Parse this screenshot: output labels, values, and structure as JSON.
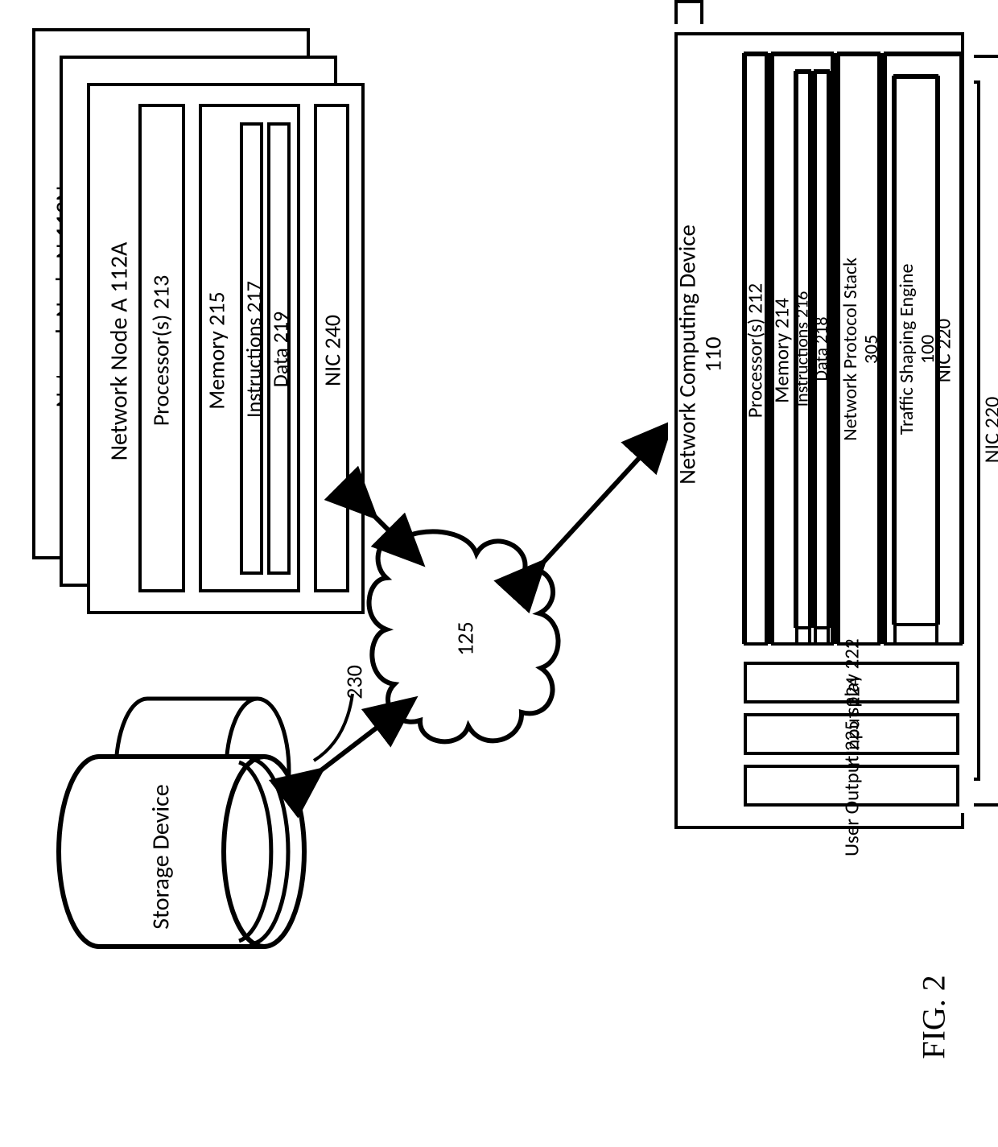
{
  "figure_label": "FIG. 2",
  "cloud": {
    "label": "125"
  },
  "network_node_n": {
    "title": "Network Node N 112N",
    "ellipsis": "…"
  },
  "network_node_a": {
    "title": "Network Node A 112A",
    "processor": "Processor(s) 213",
    "memory": "Memory 215",
    "instructions": "Instructions 217",
    "data": "Data 219",
    "nic": "NIC 240"
  },
  "storage": {
    "label": "Storage Device",
    "ref": "230"
  },
  "computing_device": {
    "title_line1": "Network Computing Device",
    "title_line2": "110",
    "processor": "Processor(s) 212",
    "memory": "Memory 214",
    "instructions": "Instructions 216",
    "data": "Data 218",
    "protocol_line1": "Network Protocol Stack",
    "protocol_line2": "305",
    "nic": "NIC 220",
    "engine_line1": "Traffic Shaping Engine",
    "engine_line2": "100",
    "display": "Display 222",
    "user_input": "User Input 224",
    "user_output": "User Output 225"
  }
}
